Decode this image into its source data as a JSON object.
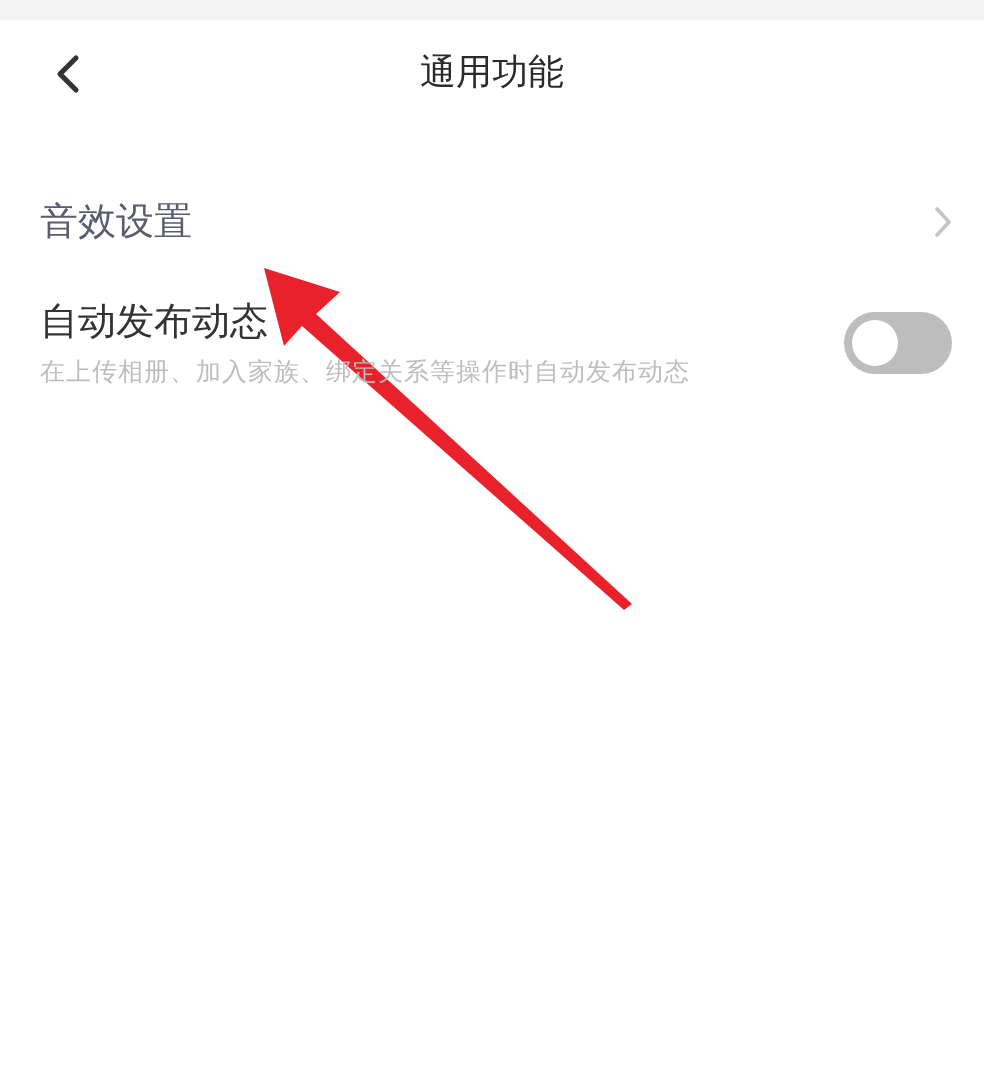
{
  "header": {
    "title": "通用功能"
  },
  "settings": [
    {
      "kind": "link",
      "label": "音效设置"
    },
    {
      "kind": "toggle",
      "label": "自动发布动态",
      "description": "在上传相册、加入家族、绑定关系等操作时自动发布动态",
      "on": false
    }
  ]
}
